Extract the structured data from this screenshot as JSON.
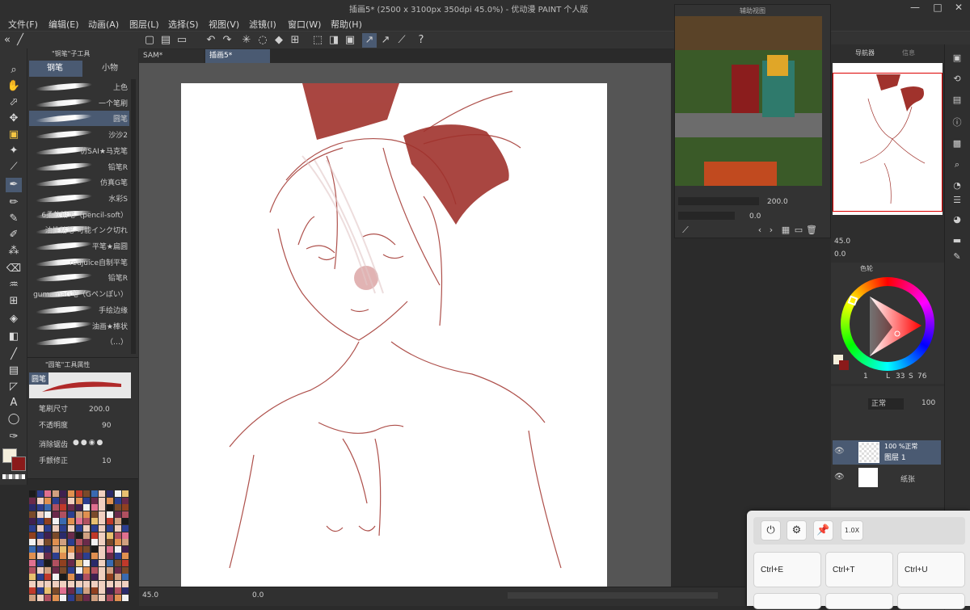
{
  "window": {
    "title": "插画5* (2500 x 3100px 350dpi 45.0%)  - 优动漫 PAINT 个人版",
    "controls": [
      "—",
      "□",
      "✕"
    ]
  },
  "menu": [
    "文件(F)",
    "编辑(E)",
    "动画(A)",
    "图层(L)",
    "选择(S)",
    "视图(V)",
    "滤镜(I)",
    "窗口(W)",
    "帮助(H)"
  ],
  "tabs": [
    {
      "label": "SAM*"
    },
    {
      "label": "插画5*"
    }
  ],
  "brush_panel": {
    "title": "\"铜笔\"子工具",
    "tabs": [
      "钢笔",
      "小物"
    ],
    "brushes": [
      "上色",
      "一个笔刷",
      "圆笔",
      "沙沙2",
      "仿SAI★马克笔",
      "铅笔R",
      "仿真G笔",
      "水彩S",
      "6柔软铅笔（pencil-soft）",
      "油性粘笔-可能インク切れ",
      "平笔★扁圆",
      "redjuice自制平笔",
      "铅笔R",
      "gumamaG笔（Gペンぽい）",
      "手绘边缘",
      "油画★棒状",
      "（…）"
    ]
  },
  "props": {
    "title": "\"圆笔\"工具属性",
    "preview_label": "圆笔",
    "rows": [
      {
        "label": "笔刷尺寸",
        "value": "200.0"
      },
      {
        "label": "不透明度",
        "value": "90"
      },
      {
        "label": "消除锯齿",
        "value": ""
      },
      {
        "label": "手颤修正",
        "value": "10"
      }
    ]
  },
  "subview": {
    "title": "辅助视图",
    "zoom": "200.0",
    "angle": "0.0"
  },
  "navigator": {
    "tabs": [
      "导航器",
      "信息"
    ],
    "zoom": "45.0",
    "angle": "0.0"
  },
  "color_wheel": {
    "tab_label": "色轮",
    "hue": "1",
    "lightness_label": "L",
    "l_value": "33",
    "s_label": "S",
    "s_value": "76"
  },
  "layers": {
    "blend_mode": "正常",
    "opacity": "100",
    "items": [
      {
        "label": "图层 1",
        "info": "100 %正常"
      },
      {
        "label": "纸张",
        "info": ""
      }
    ]
  },
  "status": {
    "zoom": "45.0",
    "value": "0.0"
  },
  "shortcut_panel": {
    "zoom_label": "1.0X",
    "keys": [
      "Ctrl+E",
      "Ctrl+T",
      "Ctrl+U"
    ]
  },
  "colors": {
    "accent": "#4a5a72",
    "ink": "#a0322c",
    "primary_swatch": "#f5efdc",
    "secondary_swatch": "#8a1a1a"
  }
}
